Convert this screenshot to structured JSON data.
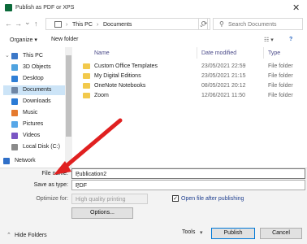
{
  "window": {
    "title": "Publish as PDF or XPS",
    "close_glyph": "✕"
  },
  "nav": {
    "back_glyph": "←",
    "forward_glyph": "→",
    "dropdown_glyph": "⌄",
    "up_glyph": "↑",
    "breadcrumb_sep": "›",
    "path": [
      "This PC",
      "Documents"
    ],
    "refresh_glyph": "⟳",
    "search_placeholder": "Search Documents",
    "search_glyph": "⚲"
  },
  "toolbar": {
    "organize": "Organize ▾",
    "new_folder": "New folder",
    "view_glyph": "☷ ▾",
    "help_glyph": "?"
  },
  "sidebar": {
    "items": [
      {
        "label": "This PC",
        "icon": "pc-icon",
        "color": "#3c78c8",
        "chevron": "⌄"
      },
      {
        "label": "3D Objects",
        "icon": "cube-icon",
        "color": "#4fa3e0"
      },
      {
        "label": "Desktop",
        "icon": "desktop-icon",
        "color": "#2f7fd6"
      },
      {
        "label": "Documents",
        "icon": "documents-icon",
        "color": "#6f87a6",
        "selected": true
      },
      {
        "label": "Downloads",
        "icon": "download-icon",
        "color": "#2b7bd6"
      },
      {
        "label": "Music",
        "icon": "music-icon",
        "color": "#e57a2e"
      },
      {
        "label": "Pictures",
        "icon": "pictures-icon",
        "color": "#57a7e8"
      },
      {
        "label": "Videos",
        "icon": "videos-icon",
        "color": "#7a56c4"
      },
      {
        "label": "Local Disk (C:)",
        "icon": "disk-icon",
        "color": "#8a8a8a"
      },
      {
        "label": "Network",
        "icon": "network-icon",
        "color": "#2f6fc8",
        "chevron": "›"
      }
    ]
  },
  "list": {
    "columns": [
      "Name",
      "Date modified",
      "Type"
    ],
    "rows": [
      {
        "name": "Custom Office Templates",
        "date": "23/05/2021 22:59",
        "type": "File folder"
      },
      {
        "name": "My Digital Editions",
        "date": "23/05/2021 21:15",
        "type": "File folder"
      },
      {
        "name": "OneNote Notebooks",
        "date": "08/05/2021 20:12",
        "type": "File folder"
      },
      {
        "name": "Zoom",
        "date": "12/06/2021 11:50",
        "type": "File folder"
      }
    ]
  },
  "form": {
    "file_name_label": "File name:",
    "file_name_value": "Publication2",
    "save_type_label": "Save as type:",
    "save_type_value": "PDF",
    "optimize_label": "Optimize for:",
    "optimize_value": "High quality printing",
    "open_after_label": "Open file after publishing",
    "open_after_checked": "✓",
    "options_button": "Options...",
    "combo_glyph": "⌄"
  },
  "footer": {
    "hide_folders": "Hide Folders",
    "hide_glyph": "⌃",
    "tools": "Tools",
    "tools_glyph": "▾",
    "publish": "Publish",
    "cancel": "Cancel"
  },
  "colors": {
    "selection": "#cce4f7",
    "accent": "#0078d7",
    "arrow": "#e02020",
    "folder": "#f2c94c"
  }
}
